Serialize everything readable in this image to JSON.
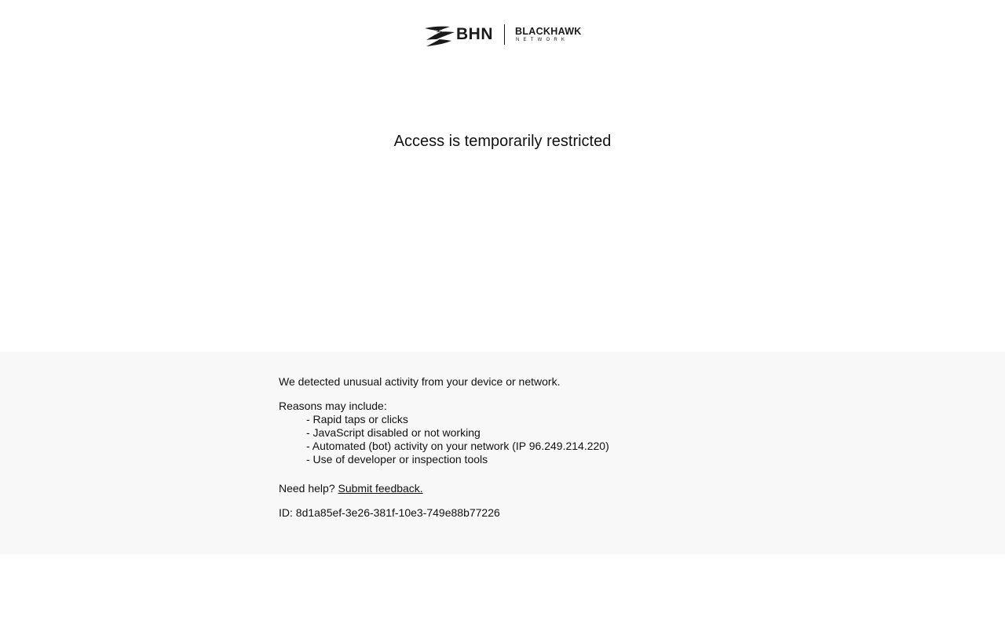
{
  "header": {
    "logo_bhn": "BHN",
    "logo_blackhawk": "BLACKHAWK",
    "logo_network": "NETWORK"
  },
  "main": {
    "title": "Access is temporarily restricted"
  },
  "info": {
    "detected": "We detected unusual activity from your device or network.",
    "reasons_heading": "Reasons may include:",
    "reasons": [
      "- Rapid taps or clicks",
      "- JavaScript disabled or not working",
      "- Automated (bot) activity on your network (IP 96.249.214.220)",
      "- Use of developer or inspection tools"
    ],
    "help_prefix": "Need help?",
    "help_link": "Submit feedback.",
    "id_line": "ID: 8d1a85ef-3e26-381f-10e3-749e88b77226"
  },
  "colors": {
    "panel_background": "#f8f8f8",
    "text": "#111111"
  }
}
